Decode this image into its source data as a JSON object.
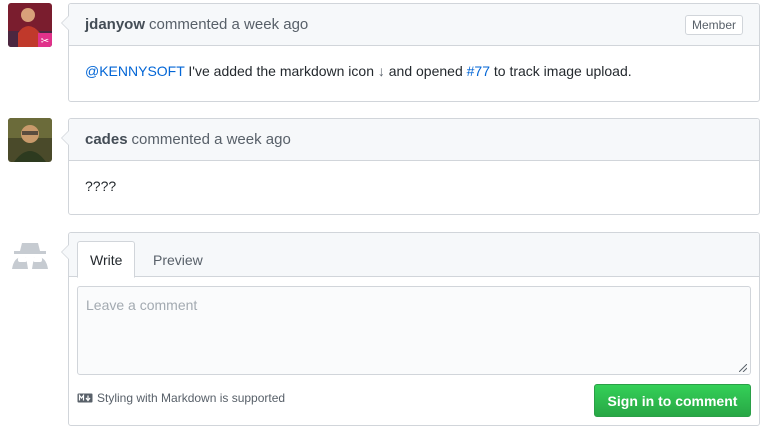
{
  "comments": [
    {
      "author": "jdanyow",
      "action": "commented a week ago",
      "badge": "Member",
      "body": {
        "mention": "@KENNYSOFT",
        "text_before_link": " I've added the markdown icon ",
        "icon_glyph": "↓",
        "text_middle": " and opened ",
        "issue_link": "#77",
        "text_after": " to track image upload."
      }
    },
    {
      "author": "cades",
      "action": "commented a week ago",
      "body": "????"
    }
  ],
  "form": {
    "tabs": [
      "Write",
      "Preview"
    ],
    "placeholder": "Leave a comment",
    "markdown_note": "Styling with Markdown is supported",
    "submit_label": "Sign in to comment"
  },
  "icons": {
    "avatar_guest": "anonymous-user-icon",
    "markdown": "markdown-icon"
  },
  "colors": {
    "link": "#0366d6",
    "button_green": "#28a745",
    "header_bg": "#f6f8fa",
    "border": "#d1d5da"
  }
}
